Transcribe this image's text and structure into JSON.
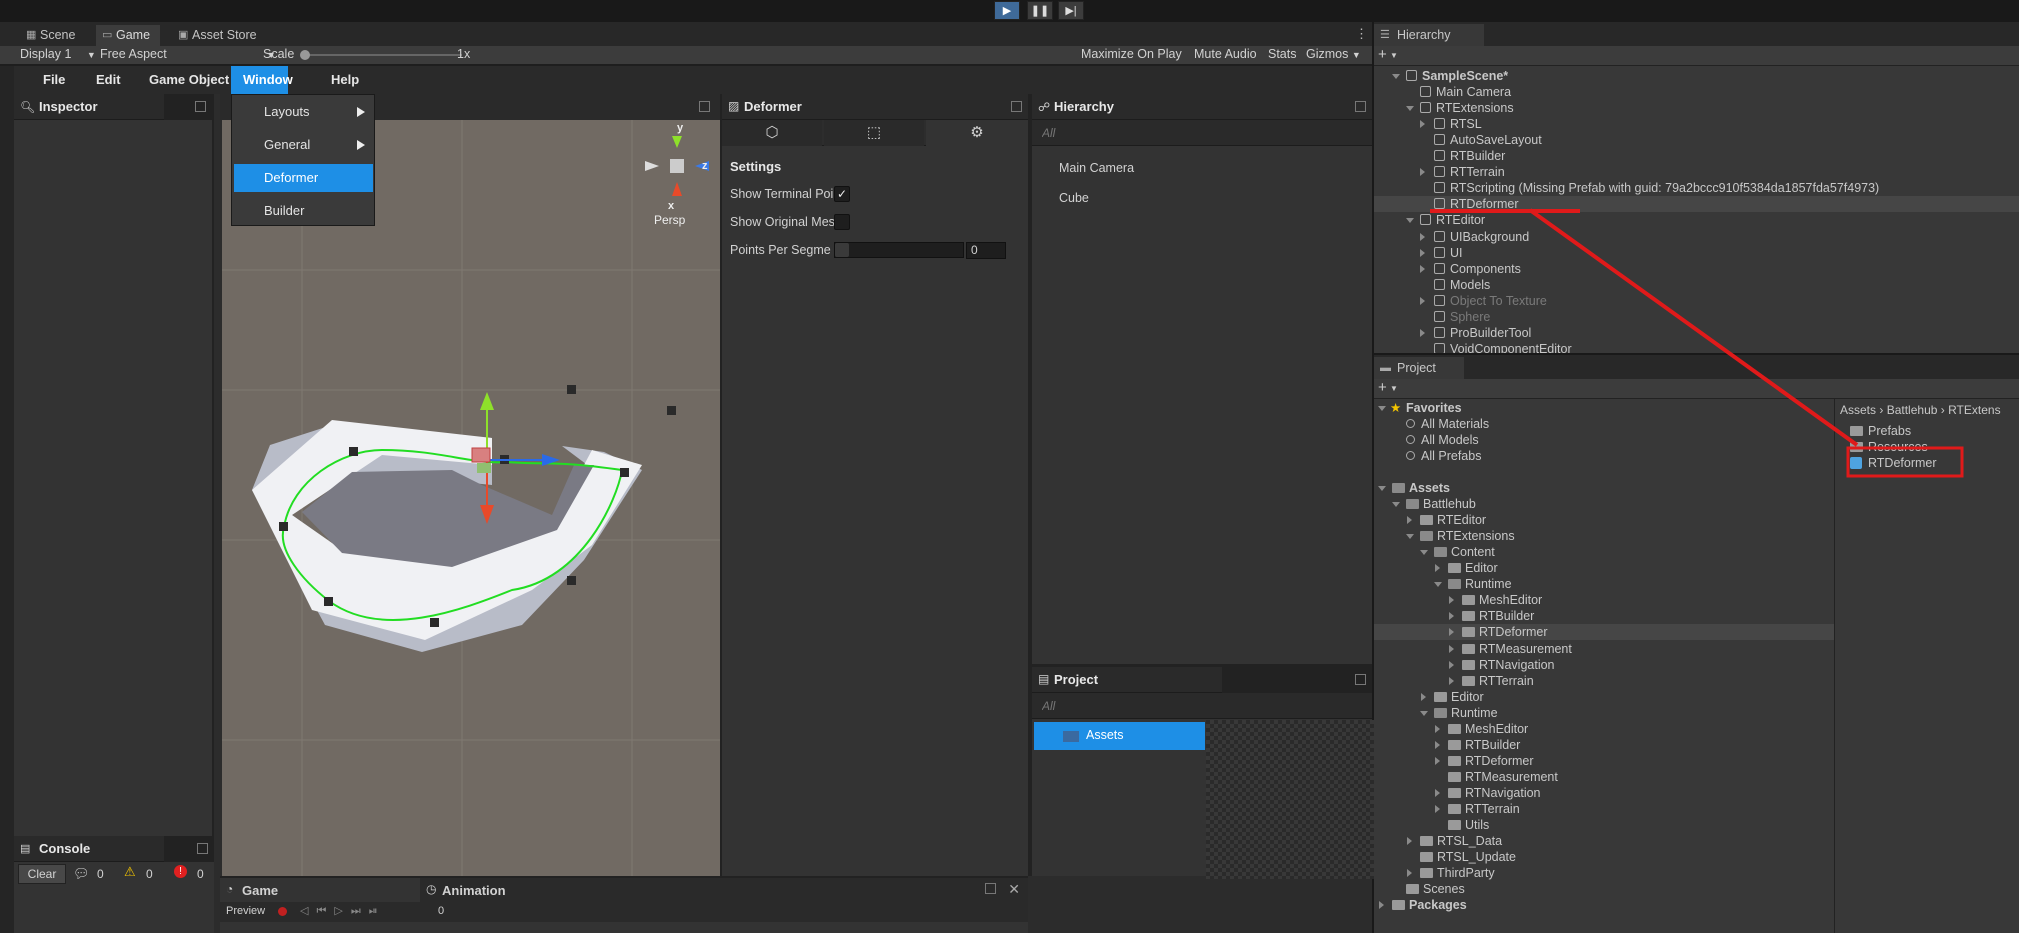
{
  "playbar": {
    "play_icon": "play-icon",
    "pause_icon": "pause-icon",
    "step_icon": "step-icon"
  },
  "game_window": {
    "tabs": [
      "Scene",
      "Game",
      "Asset Store"
    ],
    "display": "Display 1",
    "aspect": "Free Aspect",
    "scale_label": "Scale",
    "scale_value": "1x",
    "toolbar_right": [
      "Maximize On Play",
      "Mute Audio",
      "Stats",
      "Gizmos"
    ]
  },
  "app": {
    "menus": [
      "File",
      "Edit",
      "Game Object",
      "Window",
      "Help"
    ],
    "window_menu_items": [
      "Layouts",
      "General",
      "Deformer",
      "Builder"
    ],
    "inspector_title": "Inspector",
    "console": {
      "title": "Console",
      "clear": "Clear",
      "info_count": "0",
      "warning_count": "0",
      "error_count": "0"
    },
    "scene": {
      "gizmo_y": "y",
      "gizmo_z": "z",
      "gizmo_x": "x",
      "persp": "Persp"
    },
    "deformer": {
      "title": "Deformer",
      "settings": "Settings",
      "show_terminal": "Show Terminal Poi",
      "show_terminal_checked": "✓",
      "show_original": "Show Original Mes",
      "points_per_segment": "Points Per Segme",
      "points_value": "0"
    },
    "hierarchy": {
      "title": "Hierarchy",
      "search_placeholder": "All",
      "items": [
        "Main Camera",
        "Cube"
      ]
    },
    "project": {
      "title": "Project",
      "search_placeholder": "All",
      "selected_folder": "Assets"
    },
    "bottom_tabs": {
      "game": "Game",
      "animation": "Animation",
      "preview": "Preview",
      "frame": "0"
    }
  },
  "editor_hierarchy": {
    "title": "Hierarchy",
    "items": [
      {
        "label": "SampleScene*",
        "depth": 0
      },
      {
        "label": "Main Camera",
        "depth": 1
      },
      {
        "label": "RTExtensions",
        "depth": 1
      },
      {
        "label": "RTSL",
        "depth": 2
      },
      {
        "label": "AutoSaveLayout",
        "depth": 2
      },
      {
        "label": "RTBuilder",
        "depth": 2
      },
      {
        "label": "RTTerrain",
        "depth": 2
      },
      {
        "label": "RTScripting (Missing Prefab with guid: 79a2bccc910f5384da1857fda57f4973)",
        "depth": 2
      },
      {
        "label": "RTDeformer",
        "depth": 2
      },
      {
        "label": "RTEditor",
        "depth": 1
      },
      {
        "label": "UIBackground",
        "depth": 2
      },
      {
        "label": "UI",
        "depth": 2
      },
      {
        "label": "Components",
        "depth": 2
      },
      {
        "label": "Models",
        "depth": 2
      },
      {
        "label": "Object To Texture",
        "depth": 2
      },
      {
        "label": "Sphere",
        "depth": 2
      },
      {
        "label": "ProBuilderTool",
        "depth": 2
      },
      {
        "label": "VoidComponentEditor",
        "depth": 2
      }
    ]
  },
  "editor_project": {
    "title": "Project",
    "favorites_title": "Favorites",
    "favorites": [
      "All Materials",
      "All Models",
      "All Prefabs"
    ],
    "tree": [
      {
        "label": "Assets",
        "depth": 0
      },
      {
        "label": "Battlehub",
        "depth": 1
      },
      {
        "label": "RTEditor",
        "depth": 2
      },
      {
        "label": "RTExtensions",
        "depth": 2
      },
      {
        "label": "Content",
        "depth": 3
      },
      {
        "label": "Editor",
        "depth": 4
      },
      {
        "label": "Runtime",
        "depth": 4
      },
      {
        "label": "MeshEditor",
        "depth": 5
      },
      {
        "label": "RTBuilder",
        "depth": 5
      },
      {
        "label": "RTDeformer",
        "depth": 5
      },
      {
        "label": "RTMeasurement",
        "depth": 5
      },
      {
        "label": "RTNavigation",
        "depth": 5
      },
      {
        "label": "RTTerrain",
        "depth": 5
      },
      {
        "label": "Editor",
        "depth": 3
      },
      {
        "label": "Runtime",
        "depth": 3
      },
      {
        "label": "MeshEditor",
        "depth": 4
      },
      {
        "label": "RTBuilder",
        "depth": 4
      },
      {
        "label": "RTDeformer",
        "depth": 4
      },
      {
        "label": "RTMeasurement",
        "depth": 4
      },
      {
        "label": "RTNavigation",
        "depth": 4
      },
      {
        "label": "RTTerrain",
        "depth": 4
      },
      {
        "label": "Utils",
        "depth": 4
      },
      {
        "label": "RTSL_Data",
        "depth": 2
      },
      {
        "label": "RTSL_Update",
        "depth": 2
      },
      {
        "label": "ThirdParty",
        "depth": 2
      },
      {
        "label": "Scenes",
        "depth": 1
      },
      {
        "label": "Packages",
        "depth": 0
      }
    ],
    "breadcrumb": [
      "Assets",
      "Battlehub",
      "RTExtens"
    ],
    "files": [
      "Prefabs",
      "Resources",
      "RTDeformer"
    ]
  },
  "colors": {
    "accent": "#1e8fe6",
    "annotation": "#e01a1a",
    "spline": "#22dd22"
  }
}
